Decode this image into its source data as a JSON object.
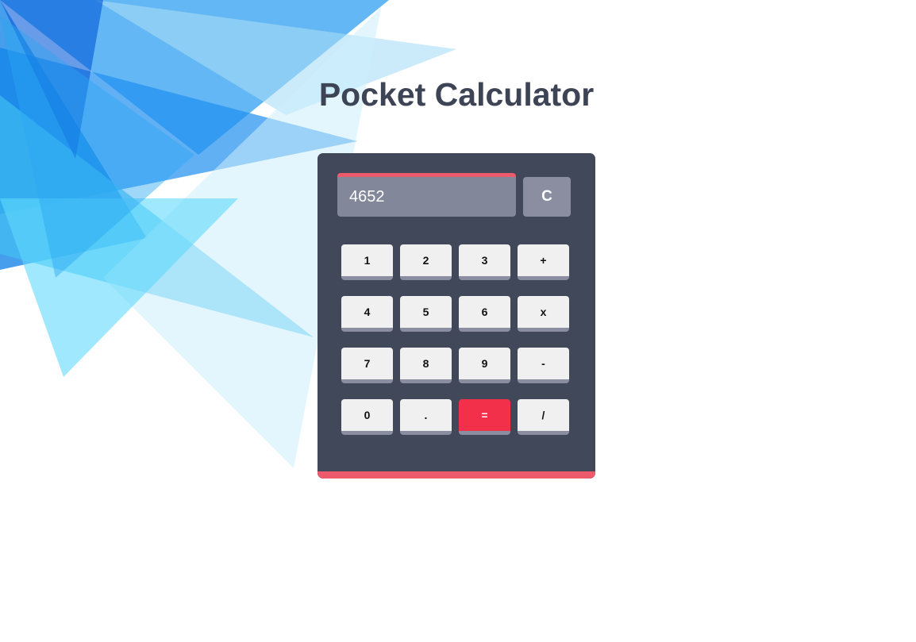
{
  "page": {
    "title": "Pocket Calculator"
  },
  "display": {
    "value": "4652"
  },
  "controls": {
    "clear_label": "C"
  },
  "keys": {
    "one": "1",
    "two": "2",
    "three": "3",
    "plus": "+",
    "four": "4",
    "five": "5",
    "six": "6",
    "multiply": "x",
    "seven": "7",
    "eight": "8",
    "nine": "9",
    "minus": "-",
    "zero": "0",
    "decimal": ".",
    "equals": "=",
    "divide": "/"
  },
  "colors": {
    "body": "#414859",
    "accent": "#ec5a6b",
    "equals": "#f2304a",
    "display": "#828799",
    "key": "#f0f0f0",
    "title": "#3d4455"
  }
}
